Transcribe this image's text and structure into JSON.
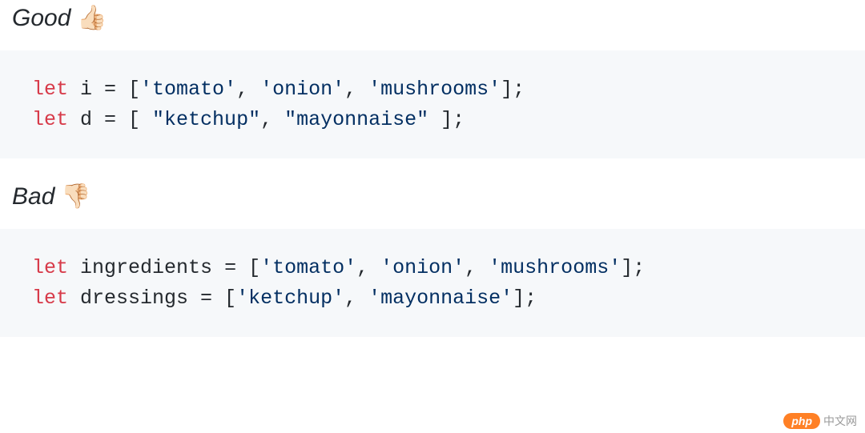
{
  "sections": {
    "good": {
      "label": "Good",
      "emoji": "👍🏻",
      "code": {
        "line1": {
          "kw": "let",
          "name": " i ",
          "eq": "= [",
          "s1": "'tomato'",
          "c1": ", ",
          "s2": "'onion'",
          "c2": ", ",
          "s3": "'mushrooms'",
          "end": "];"
        },
        "line2": {
          "kw": "let",
          "name": " d ",
          "eq": "= [ ",
          "s1": "\"ketchup\"",
          "c1": ", ",
          "s2": "\"mayonnaise\"",
          "end": " ];"
        }
      }
    },
    "bad": {
      "label": "Bad",
      "emoji": "👎🏻",
      "code": {
        "line1": {
          "kw": "let",
          "name": " ingredients ",
          "eq": "= [",
          "s1": "'tomato'",
          "c1": ", ",
          "s2": "'onion'",
          "c2": ", ",
          "s3": "'mushrooms'",
          "end": "];"
        },
        "line2": {
          "kw": "let",
          "name": " dressings ",
          "eq": "= [",
          "s1": "'ketchup'",
          "c1": ", ",
          "s2": "'mayonnaise'",
          "end": "];"
        }
      }
    }
  },
  "watermark": {
    "badge": "php",
    "text": "中文网"
  }
}
